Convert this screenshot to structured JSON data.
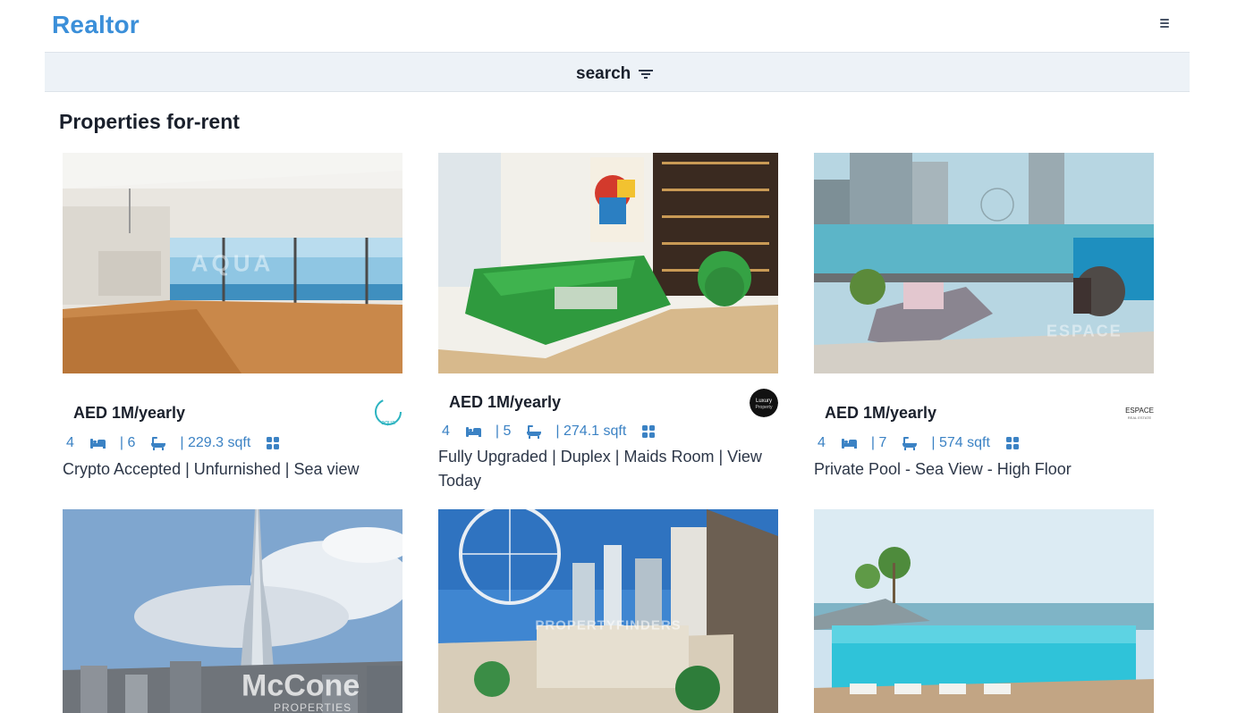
{
  "brand": "Realtor",
  "search": {
    "label": "search"
  },
  "page_title": "Properties for-rent",
  "listings": [
    {
      "price": "AED 1M/yearly",
      "rooms": "4",
      "baths": "| 6",
      "area": "| 229.3 sqft",
      "title": "Crypto Accepted | Unfurnished | Sea view",
      "watermark": "AQUA",
      "agency_logo": "aqua-logo"
    },
    {
      "price": "AED 1M/yearly",
      "rooms": "4",
      "baths": "| 5",
      "area": "| 274.1 sqft",
      "title": "Fully Upgraded | Duplex | Maids Room | View Today",
      "watermark": "",
      "agency_logo": "luxury-property-logo"
    },
    {
      "price": "AED 1M/yearly",
      "rooms": "4",
      "baths": "| 7",
      "area": "| 574 sqft",
      "title": "Private Pool - Sea View - High Floor",
      "watermark": "ESPACE",
      "agency_logo": "espace-logo"
    },
    {
      "price": "",
      "rooms": "",
      "baths": "",
      "area": "",
      "title": "",
      "watermark": "McCone",
      "watermark_sub": "PROPERTIES"
    },
    {
      "price": "",
      "rooms": "",
      "baths": "",
      "area": "",
      "title": "",
      "watermark": "PROPERTYFINDERS"
    },
    {
      "price": "",
      "rooms": "",
      "baths": "",
      "area": "",
      "title": "",
      "watermark": ""
    }
  ],
  "colors": {
    "brand": "#3b8fd9",
    "accent": "#3b82c4",
    "search_bg": "#edf2f7",
    "text": "#1a202c"
  }
}
